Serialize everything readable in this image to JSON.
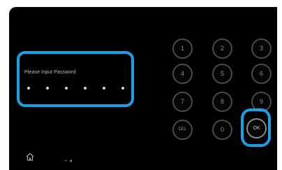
{
  "password_prompt": {
    "label": "Please Input Password",
    "masked_chars": [
      "•",
      "•",
      "•",
      "•",
      "•",
      "•"
    ]
  },
  "keypad": {
    "keys": [
      {
        "label": "1",
        "name": "keypad-key-1"
      },
      {
        "label": "2",
        "name": "keypad-key-2"
      },
      {
        "label": "3",
        "name": "keypad-key-3"
      },
      {
        "label": "4",
        "name": "keypad-key-4"
      },
      {
        "label": "5",
        "name": "keypad-key-5"
      },
      {
        "label": "6",
        "name": "keypad-key-6"
      },
      {
        "label": "7",
        "name": "keypad-key-7"
      },
      {
        "label": "8",
        "name": "keypad-key-8"
      },
      {
        "label": "9",
        "name": "keypad-key-9"
      },
      {
        "label": "DEL",
        "name": "keypad-delete-button"
      },
      {
        "label": "0",
        "name": "keypad-key-0"
      },
      {
        "label": "OK",
        "name": "keypad-ok-button"
      }
    ]
  },
  "bottom_bar": {
    "home_icon": "home-icon",
    "network_label": "⌁ ◂"
  },
  "colors": {
    "highlight": "#1aa0e6",
    "background": "#000000",
    "key_border": "#4a4a4a"
  }
}
